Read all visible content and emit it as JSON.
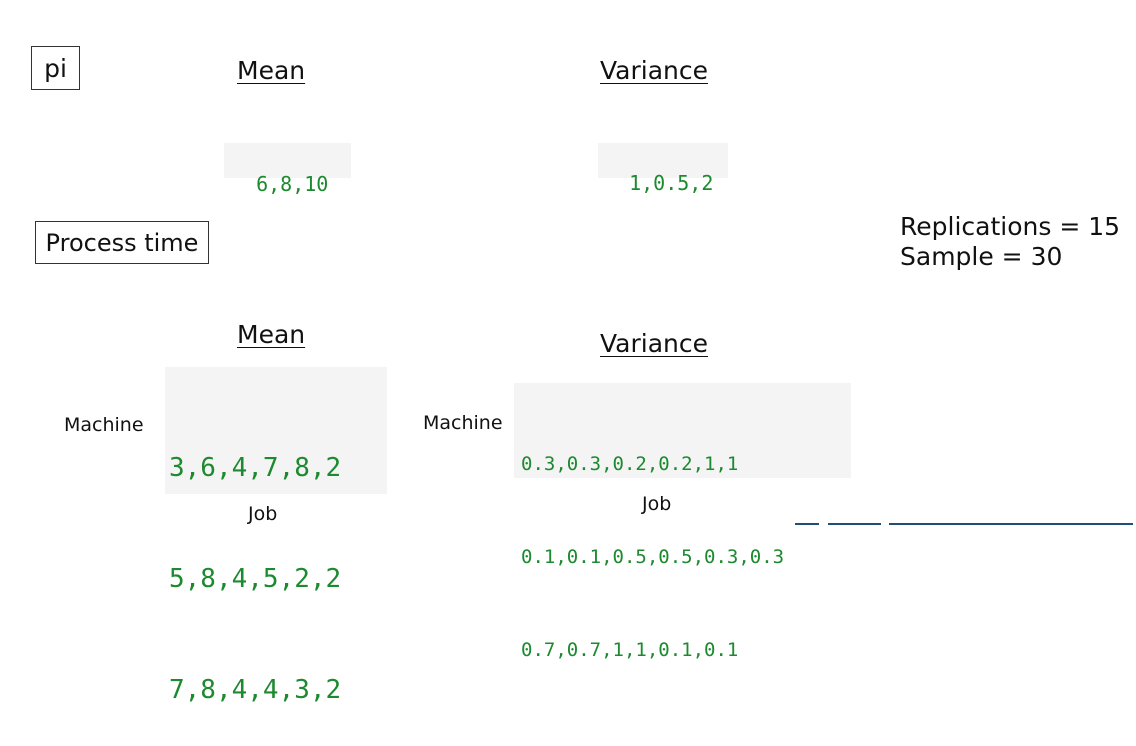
{
  "pi_box": {
    "label": "pi"
  },
  "pi_section": {
    "mean_heading": "Mean",
    "variance_heading": "Variance",
    "mean_values": "6,8,10",
    "variance_values": "1,0.5,2"
  },
  "process_time_box": {
    "label": "Process time"
  },
  "stats": {
    "replications": "Replications = 15",
    "sample": "Sample = 30"
  },
  "process_mean": {
    "heading": "Mean",
    "row_label": "Machine",
    "col_label": "Job",
    "rows": [
      "3,6,4,7,8,2",
      "5,8,4,5,2,2",
      "7,8,4,4,3,2"
    ]
  },
  "process_variance": {
    "heading": "Variance",
    "row_label": "Machine",
    "col_label": "Job",
    "rows": [
      "0.3,0.3,0.2,0.2,1,1",
      "0.1,0.1,0.5,0.5,0.3,0.3",
      "0.7,0.7,1,1,0.1,0.1"
    ]
  },
  "colors": {
    "code_text": "#1d8a2f",
    "code_background": "#f4f4f4",
    "border": "#333333"
  }
}
